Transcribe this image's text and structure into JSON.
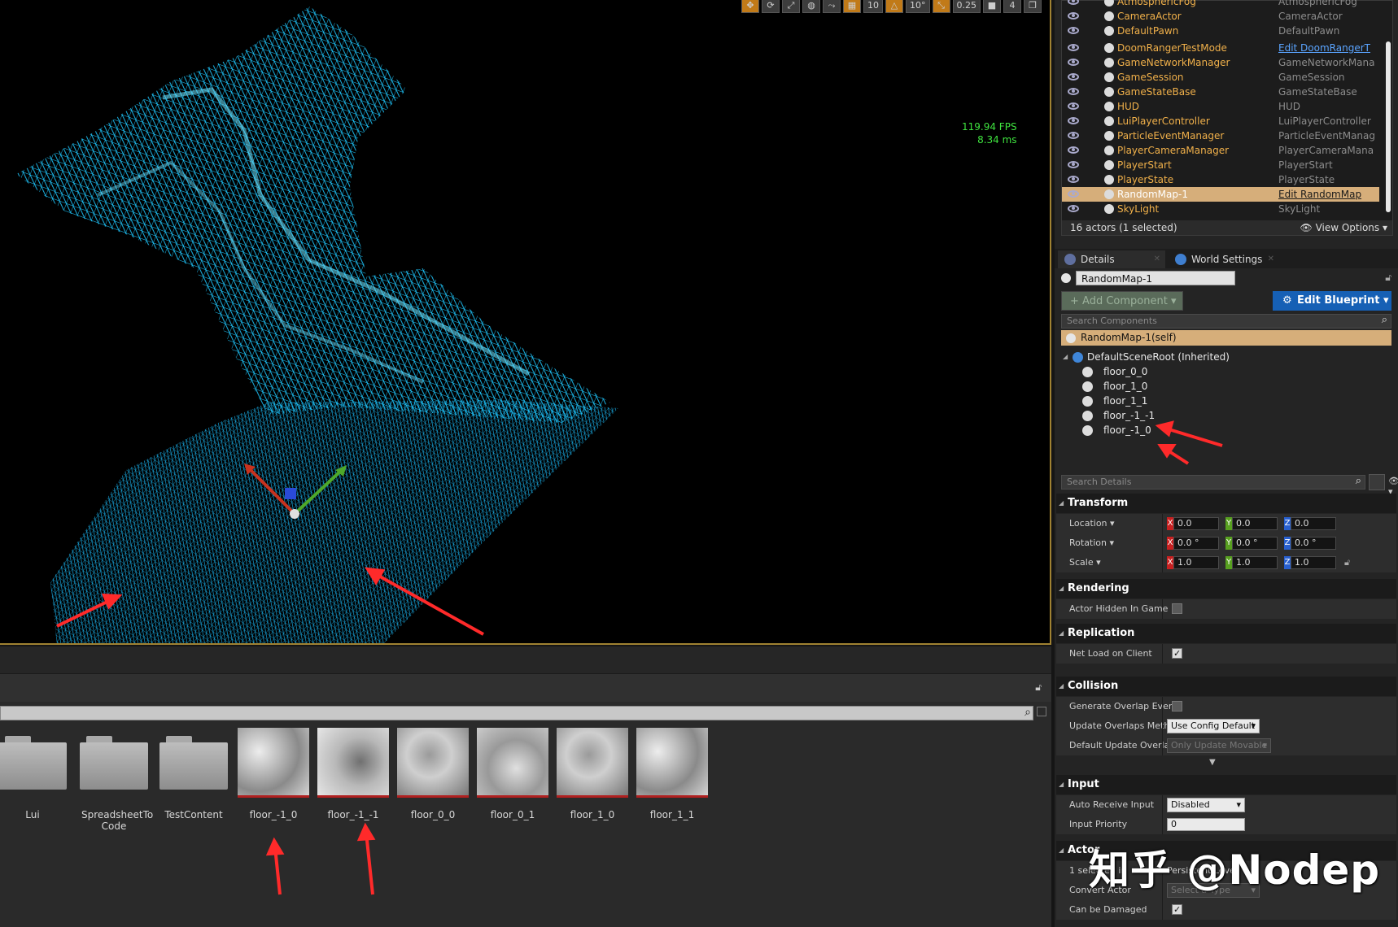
{
  "viewport": {
    "toolbar": [
      "10",
      "10°",
      "0.25",
      "4"
    ],
    "fps": "119.94 FPS",
    "ms": "8.34 ms"
  },
  "outliner": {
    "rows": [
      {
        "label": "AtmosphericFog",
        "type": "AtmosphericFog",
        "link": false,
        "selected": false
      },
      {
        "label": "CameraActor",
        "type": "CameraActor",
        "link": false,
        "selected": false
      },
      {
        "label": "DefaultPawn",
        "type": "DefaultPawn",
        "link": false,
        "selected": false
      },
      {
        "label": "DoomRangerTestMode",
        "type": "Edit DoomRangerT",
        "link": true,
        "selected": false
      },
      {
        "label": "GameNetworkManager",
        "type": "GameNetworkMana",
        "link": false,
        "selected": false
      },
      {
        "label": "GameSession",
        "type": "GameSession",
        "link": false,
        "selected": false
      },
      {
        "label": "GameStateBase",
        "type": "GameStateBase",
        "link": false,
        "selected": false
      },
      {
        "label": "HUD",
        "type": "HUD",
        "link": false,
        "selected": false
      },
      {
        "label": "LuiPlayerController",
        "type": "LuiPlayerController",
        "link": false,
        "selected": false
      },
      {
        "label": "ParticleEventManager",
        "type": "ParticleEventManag",
        "link": false,
        "selected": false
      },
      {
        "label": "PlayerCameraManager",
        "type": "PlayerCameraMana",
        "link": false,
        "selected": false
      },
      {
        "label": "PlayerStart",
        "type": "PlayerStart",
        "link": false,
        "selected": false
      },
      {
        "label": "PlayerState",
        "type": "PlayerState",
        "link": false,
        "selected": false
      },
      {
        "label": "RandomMap-1",
        "type": "Edit RandomMap",
        "link": true,
        "selected": true
      },
      {
        "label": "SkyLight",
        "type": "SkyLight",
        "link": false,
        "selected": false
      }
    ],
    "count": "16 actors (1 selected)",
    "view_options": "View Options"
  },
  "tabs": {
    "details": "Details",
    "world_settings": "World Settings"
  },
  "details": {
    "actor_name": "RandomMap-1",
    "add_component": "+ Add Component",
    "edit_blueprint": "Edit Blueprint",
    "search_components": "Search Components",
    "self_row": "RandomMap-1(self)",
    "root": "DefaultSceneRoot (Inherited)",
    "components": [
      "floor_0_0",
      "floor_1_0",
      "floor_1_1",
      "floor_-1_-1",
      "floor_-1_0"
    ],
    "search_details": "Search Details"
  },
  "transform": {
    "title": "Transform",
    "location": {
      "label": "Location",
      "x": "0.0",
      "y": "0.0",
      "z": "0.0"
    },
    "rotation": {
      "label": "Rotation",
      "x": "0.0 °",
      "y": "0.0 °",
      "z": "0.0 °"
    },
    "scale": {
      "label": "Scale",
      "x": "1.0",
      "y": "1.0",
      "z": "1.0"
    }
  },
  "rendering": {
    "title": "Rendering",
    "hidden_label": "Actor Hidden In Game",
    "hidden": false
  },
  "replication": {
    "title": "Replication",
    "netload_label": "Net Load on Client",
    "netload": true
  },
  "collision": {
    "title": "Collision",
    "overlap_label": "Generate Overlap Events",
    "overlap": false,
    "update_label": "Update Overlaps Method",
    "update_value": "Use Config Default",
    "default_label": "Default Update Overlaps",
    "default_value": "Only Update Movable"
  },
  "input": {
    "title": "Input",
    "receive_label": "Auto Receive Input",
    "receive_value": "Disabled",
    "priority_label": "Input Priority",
    "priority_value": "0"
  },
  "actor": {
    "title": "Actor",
    "selected_label": "1 selected in",
    "selected_value": "Persistent Level",
    "convert_label": "Convert Actor",
    "convert_value": "Select a Type",
    "damage_label": "Can be Damaged",
    "damage": true
  },
  "content_browser": {
    "assets": [
      {
        "name": "Lui",
        "kind": "folder"
      },
      {
        "name": "SpreadsheetTo Code",
        "kind": "folder"
      },
      {
        "name": "TestContent",
        "kind": "folder"
      },
      {
        "name": "floor_-1_0",
        "kind": "texture"
      },
      {
        "name": "floor_-1_-1",
        "kind": "texture"
      },
      {
        "name": "floor_0_0",
        "kind": "texture"
      },
      {
        "name": "floor_0_1",
        "kind": "texture"
      },
      {
        "name": "floor_1_0",
        "kind": "texture"
      },
      {
        "name": "floor_1_1",
        "kind": "texture"
      }
    ]
  },
  "watermark": "知乎 @Nodep",
  "colors": {
    "accent": "#1660b5",
    "selection": "#d6ae7a",
    "wireframe": "#1ec8ff",
    "outliner_label": "#f0b04a"
  }
}
